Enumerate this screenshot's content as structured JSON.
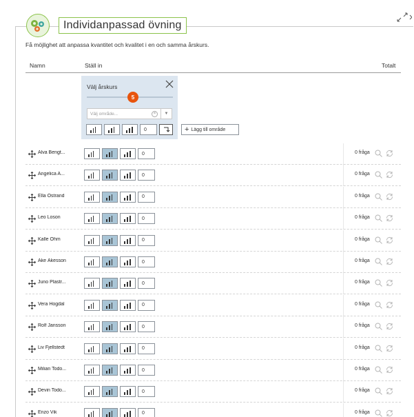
{
  "header": {
    "title": "Individanpassad övning",
    "description": "Få möjlighet att anpassa kvantitet och kvalitet i en och samma årskurs."
  },
  "columns": {
    "name": "Namn",
    "settings": "Ställ in",
    "total": "Totalt"
  },
  "panel": {
    "title": "Välj årskurs",
    "grade_value": "5",
    "area_placeholder": "Välj område...",
    "quantity_value": "0",
    "add_area_label": "Lägg till område",
    "selected_level": "none"
  },
  "students": [
    {
      "name": "Alva Bengt...",
      "quantity": "0",
      "count": "0 fråga",
      "selected_level": 2
    },
    {
      "name": "Angelica A...",
      "quantity": "0",
      "count": "0 fråga",
      "selected_level": 2
    },
    {
      "name": "Ella Östrand",
      "quantity": "0",
      "count": "0 fråga",
      "selected_level": 2
    },
    {
      "name": "Leo Loson",
      "quantity": "0",
      "count": "0 fråga",
      "selected_level": 2
    },
    {
      "name": "Kalle Ohm",
      "quantity": "0",
      "count": "0 fråga",
      "selected_level": 2
    },
    {
      "name": "Åke Åkesson",
      "quantity": "0",
      "count": "0 fråga",
      "selected_level": 2
    },
    {
      "name": "Juno Plastr...",
      "quantity": "0",
      "count": "0 fråga",
      "selected_level": 2
    },
    {
      "name": "Vera Hogdal",
      "quantity": "0",
      "count": "0 fråga",
      "selected_level": 2
    },
    {
      "name": "Rolf Jansson",
      "quantity": "0",
      "count": "0 fråga",
      "selected_level": 2
    },
    {
      "name": "Liv Fjellstedt",
      "quantity": "0",
      "count": "0 fråga",
      "selected_level": 2
    },
    {
      "name": "Milian Todo...",
      "quantity": "0",
      "count": "0 fråga",
      "selected_level": 2
    },
    {
      "name": "Devin Todo...",
      "quantity": "0",
      "count": "0 fråga",
      "selected_level": 2
    },
    {
      "name": "Enzo Vik",
      "quantity": "0",
      "count": "0 fråga",
      "selected_level": 2
    }
  ],
  "icons": {
    "logo": "gears-icon",
    "expand": "expand-arrows-icon",
    "close": "close-icon",
    "clear": "clear-circle-icon",
    "dropdown": "caret-down-icon",
    "enter": "enter-arrow-icon",
    "plus": "plus-icon",
    "move": "move-arrows-icon",
    "search": "search-icon",
    "refresh": "refresh-icon",
    "levels": [
      "difficulty-easy-icon",
      "difficulty-medium-icon",
      "difficulty-hard-icon"
    ]
  },
  "colors": {
    "accent_green": "#8bc34a",
    "slider_knob": "#e8540d",
    "panel_bg": "#dce6f0",
    "selected_level_bg": "#a9c5d6"
  }
}
